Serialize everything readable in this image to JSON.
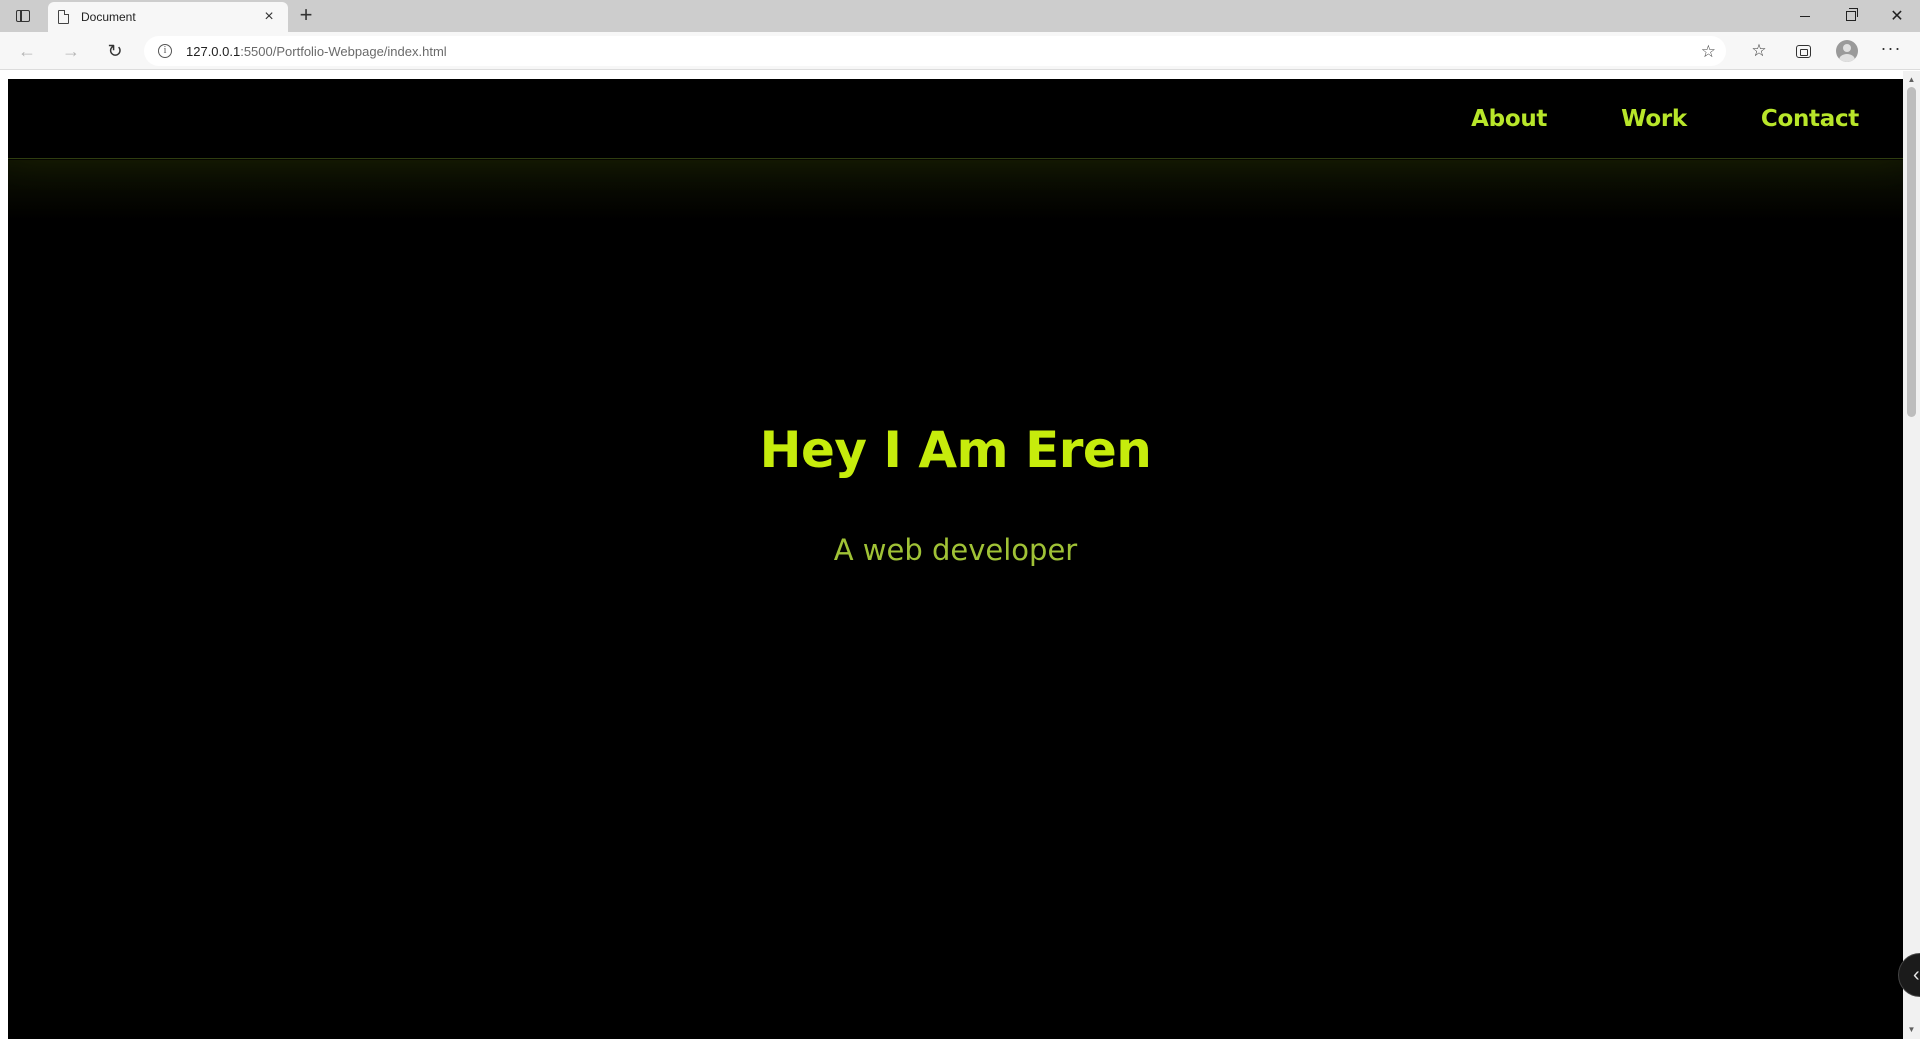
{
  "browser": {
    "tab": {
      "title": "Document",
      "close_glyph": "×"
    },
    "new_tab_glyph": "+",
    "toolbar": {
      "back_glyph": "←",
      "forward_glyph": "→",
      "refresh_glyph": "↻",
      "url_host": "127.0.0.1",
      "url_path": ":5500/Portfolio-Webpage/index.html",
      "favorite_glyph": "☆",
      "favorites_glyph": "☆",
      "more_glyph": "···"
    },
    "window": {
      "close_glyph": "✕"
    }
  },
  "site": {
    "nav": [
      {
        "label": "About"
      },
      {
        "label": "Work"
      },
      {
        "label": "Contact"
      }
    ],
    "hero": {
      "title": "Hey I Am Eren",
      "subtitle": "A web developer"
    }
  },
  "colors": {
    "accent": "#c6ec0c",
    "nav_link": "#b8e62a",
    "subtitle": "#a0c236",
    "background": "#000000"
  },
  "icons": {
    "tab_actions": "tab-actions-icon",
    "page": "page-icon",
    "info": "info-icon",
    "favorite": "star-add-icon",
    "favorites": "favorites-icon",
    "collections": "collections-icon",
    "profile": "profile-avatar-icon",
    "more": "more-icon",
    "side_handle": "chevron-left-icon"
  }
}
